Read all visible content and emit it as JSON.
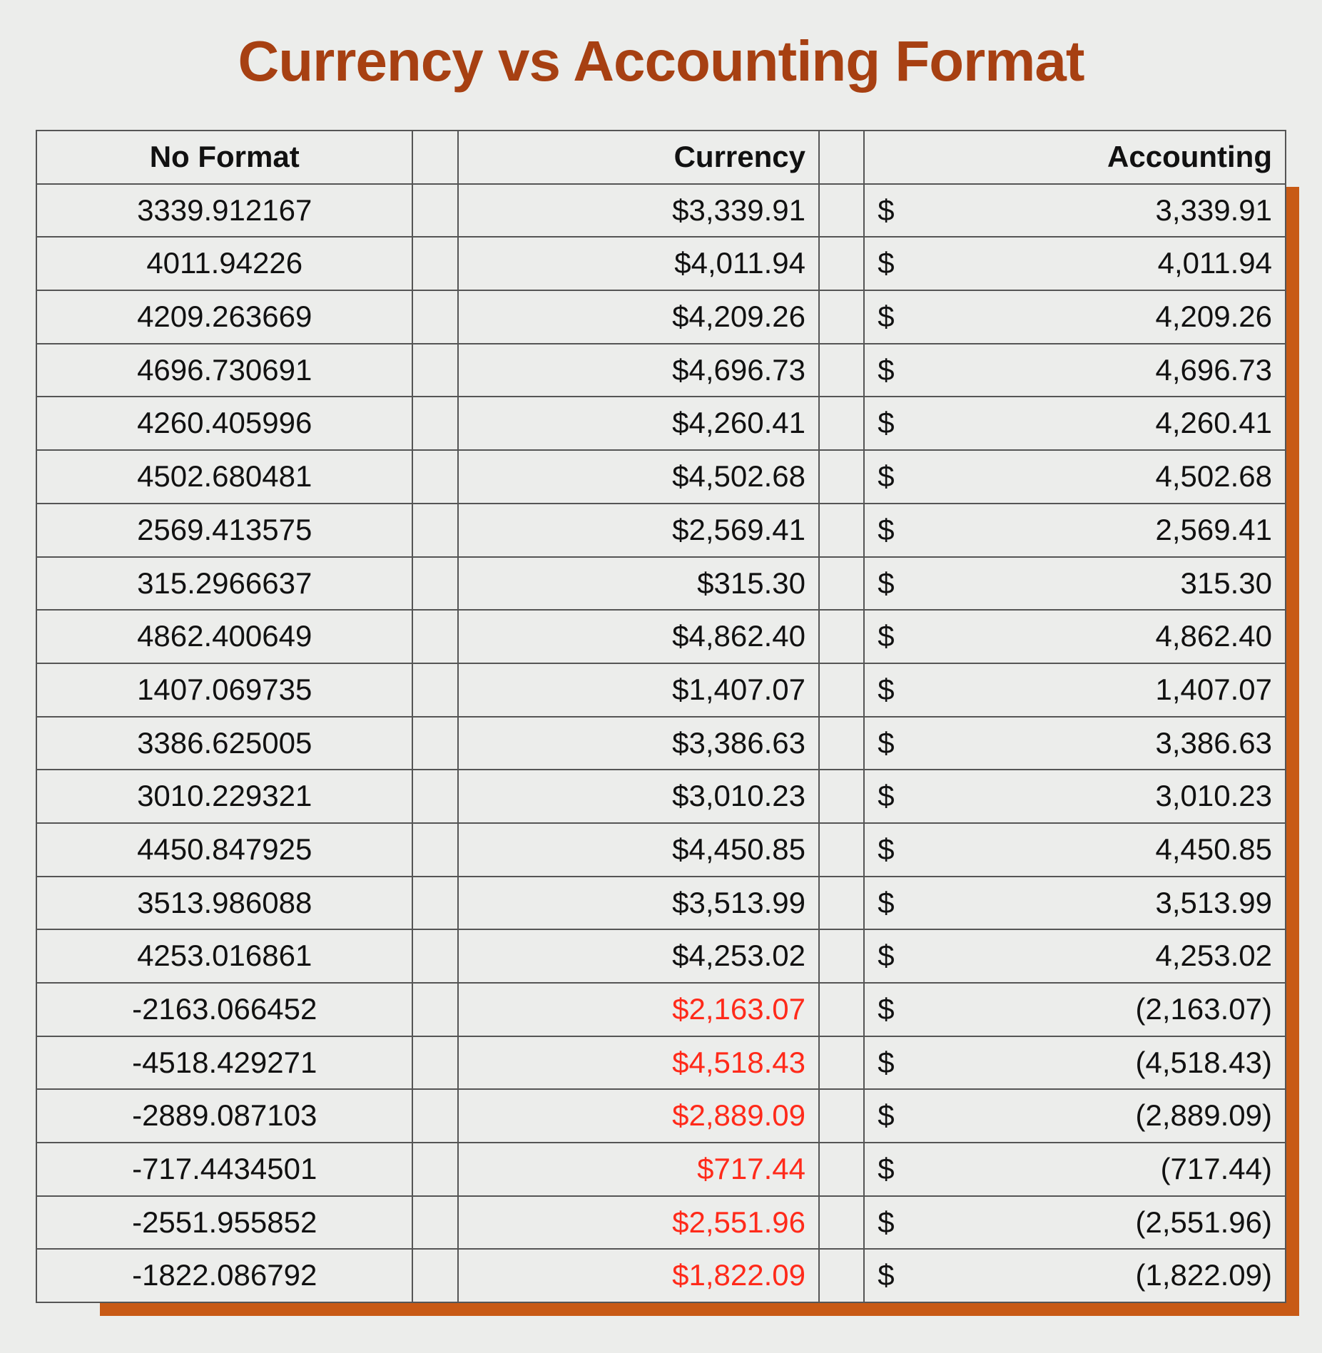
{
  "title": "Currency vs Accounting Format",
  "headers": {
    "noformat": "No Format",
    "currency": "Currency",
    "accounting": "Accounting"
  },
  "dollar_sign": "$",
  "negative_color": "#ff2a1a",
  "chart_data": {
    "type": "table",
    "title": "Currency vs Accounting Format",
    "columns": [
      "No Format",
      "Currency",
      "Accounting"
    ],
    "rows": [
      {
        "noformat": "3339.912167",
        "currency": "$3,339.91",
        "currency_negative": false,
        "accounting": "3,339.91"
      },
      {
        "noformat": "4011.94226",
        "currency": "$4,011.94",
        "currency_negative": false,
        "accounting": "4,011.94"
      },
      {
        "noformat": "4209.263669",
        "currency": "$4,209.26",
        "currency_negative": false,
        "accounting": "4,209.26"
      },
      {
        "noformat": "4696.730691",
        "currency": "$4,696.73",
        "currency_negative": false,
        "accounting": "4,696.73"
      },
      {
        "noformat": "4260.405996",
        "currency": "$4,260.41",
        "currency_negative": false,
        "accounting": "4,260.41"
      },
      {
        "noformat": "4502.680481",
        "currency": "$4,502.68",
        "currency_negative": false,
        "accounting": "4,502.68"
      },
      {
        "noformat": "2569.413575",
        "currency": "$2,569.41",
        "currency_negative": false,
        "accounting": "2,569.41"
      },
      {
        "noformat": "315.2966637",
        "currency": "$315.30",
        "currency_negative": false,
        "accounting": "315.30"
      },
      {
        "noformat": "4862.400649",
        "currency": "$4,862.40",
        "currency_negative": false,
        "accounting": "4,862.40"
      },
      {
        "noformat": "1407.069735",
        "currency": "$1,407.07",
        "currency_negative": false,
        "accounting": "1,407.07"
      },
      {
        "noformat": "3386.625005",
        "currency": "$3,386.63",
        "currency_negative": false,
        "accounting": "3,386.63"
      },
      {
        "noformat": "3010.229321",
        "currency": "$3,010.23",
        "currency_negative": false,
        "accounting": "3,010.23"
      },
      {
        "noformat": "4450.847925",
        "currency": "$4,450.85",
        "currency_negative": false,
        "accounting": "4,450.85"
      },
      {
        "noformat": "3513.986088",
        "currency": "$3,513.99",
        "currency_negative": false,
        "accounting": "3,513.99"
      },
      {
        "noformat": "4253.016861",
        "currency": "$4,253.02",
        "currency_negative": false,
        "accounting": "4,253.02"
      },
      {
        "noformat": "-2163.066452",
        "currency": "$2,163.07",
        "currency_negative": true,
        "accounting": "(2,163.07)"
      },
      {
        "noformat": "-4518.429271",
        "currency": "$4,518.43",
        "currency_negative": true,
        "accounting": "(4,518.43)"
      },
      {
        "noformat": "-2889.087103",
        "currency": "$2,889.09",
        "currency_negative": true,
        "accounting": "(2,889.09)"
      },
      {
        "noformat": "-717.4434501",
        "currency": "$717.44",
        "currency_negative": true,
        "accounting": "(717.44)"
      },
      {
        "noformat": "-2551.955852",
        "currency": "$2,551.96",
        "currency_negative": true,
        "accounting": "(2,551.96)"
      },
      {
        "noformat": "-1822.086792",
        "currency": "$1,822.09",
        "currency_negative": true,
        "accounting": "(1,822.09)"
      }
    ]
  }
}
